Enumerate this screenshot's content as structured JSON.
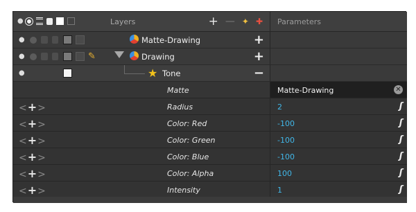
{
  "layers_panel": {
    "title": "Layers",
    "header_icons": [
      "glasses-icon",
      "eye-icon",
      "stack-icon",
      "lock-icon",
      "color-swatch-icon",
      "frame-icon"
    ],
    "toolbar": [
      "add-layer-icon",
      "remove-layer-icon",
      "add-peg-icon",
      "effect-icon"
    ],
    "layers": [
      {
        "name": "Matte-Drawing",
        "icon": "drawing-layer-icon",
        "action": "+"
      },
      {
        "name": "Drawing",
        "icon": "drawing-layer-icon",
        "action": "+"
      },
      {
        "name": "Tone",
        "icon": "effect-star-icon",
        "action": "−"
      }
    ]
  },
  "parameters_panel": {
    "title": "Parameters",
    "rows": [
      {
        "label": "Matte",
        "value": "Matte-Drawing"
      },
      {
        "label": "Radius",
        "value": "2"
      },
      {
        "label": "Color: Red",
        "value": "-100"
      },
      {
        "label": "Color: Green",
        "value": "-100"
      },
      {
        "label": "Color: Blue",
        "value": "-100"
      },
      {
        "label": "Color: Alpha",
        "value": "100"
      },
      {
        "label": "Intensity",
        "value": "1"
      }
    ]
  },
  "colors": {
    "panel_bg": "#3b3b3b",
    "value_blue": "#41b7e8",
    "star_yellow": "#f2c21b"
  }
}
